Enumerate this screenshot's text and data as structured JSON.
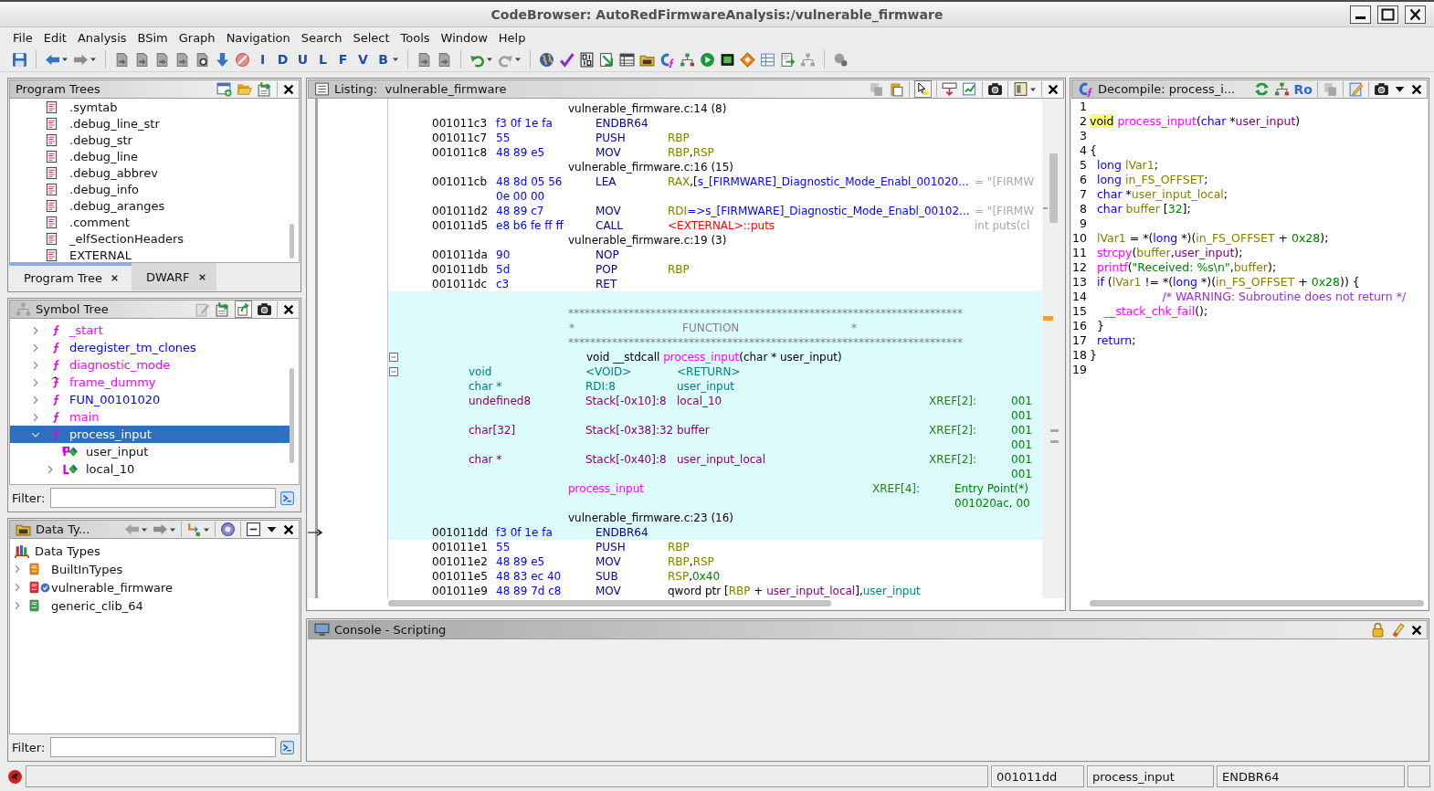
{
  "window": {
    "title": "CodeBrowser: AutoRedFirmwareAnalysis:/vulnerable_firmware"
  },
  "menu": [
    "File",
    "Edit",
    "Analysis",
    "BSim",
    "Graph",
    "Navigation",
    "Search",
    "Select",
    "Tools",
    "Window",
    "Help"
  ],
  "toolbar": {
    "letter_buttons": [
      "I",
      "D",
      "U",
      "L",
      "F",
      "V",
      "B"
    ]
  },
  "program_trees": {
    "title": "Program Trees",
    "items": [
      ".symtab",
      ".debug_line_str",
      ".debug_str",
      ".debug_line",
      ".debug_abbrev",
      ".debug_info",
      ".debug_aranges",
      ".comment",
      "_elfSectionHeaders",
      "EXTERNAL"
    ],
    "tabs": [
      {
        "label": "Program Tree",
        "selected": true
      },
      {
        "label": "DWARF",
        "selected": false
      }
    ]
  },
  "symbol_tree": {
    "title": "Symbol Tree",
    "items": [
      {
        "name": "_start",
        "kind": "function",
        "color": "#ff00ff",
        "expanded": false,
        "selected": false
      },
      {
        "name": "deregister_tm_clones",
        "kind": "function",
        "color": "#0000ff",
        "expanded": false,
        "selected": false
      },
      {
        "name": "diagnostic_mode",
        "kind": "function",
        "color": "#ff00ff",
        "expanded": false,
        "selected": false
      },
      {
        "name": "frame_dummy",
        "kind": "thunk",
        "color": "#ff00ff",
        "expanded": false,
        "selected": false
      },
      {
        "name": "FUN_00101020",
        "kind": "function",
        "color": "#0000ff",
        "expanded": false,
        "selected": false
      },
      {
        "name": "main",
        "kind": "function",
        "color": "#ff00ff",
        "expanded": false,
        "selected": false
      },
      {
        "name": "process_input",
        "kind": "function",
        "expanded": true,
        "selected": true,
        "children": [
          {
            "name": "user_input",
            "kind": "parameter",
            "selected": false
          },
          {
            "name": "local_10",
            "kind": "local",
            "expanded": false,
            "selected": false
          }
        ]
      }
    ],
    "filter": {
      "label": "Filter:"
    }
  },
  "data_types": {
    "title": "Data Ty...",
    "root": {
      "name": "Data Types",
      "children": [
        {
          "name": "BuiltInTypes",
          "kind": "builtin",
          "expanded": false
        },
        {
          "name": "vulnerable_firmware",
          "kind": "program",
          "expanded": false
        },
        {
          "name": "generic_clib_64",
          "kind": "archive",
          "expanded": false
        }
      ]
    },
    "filter": {
      "label": "Filter:"
    }
  },
  "listing": {
    "title": "Listing:  vulnerable_firmware",
    "lines": [
      {
        "kind": "source",
        "text": "vulnerable_firmware.c:14 (8)",
        "highlighted": false
      },
      {
        "kind": "instruction",
        "address": "001011c3",
        "bytes": "f3 0f 1e fa",
        "mnemonic": "ENDBR64",
        "highlighted": false
      },
      {
        "kind": "instruction",
        "address": "001011c7",
        "bytes": "55",
        "mnemonic": "PUSH",
        "operands": [
          {
            "kind": "register",
            "text": "RBP"
          }
        ],
        "highlighted": false
      },
      {
        "kind": "instruction",
        "address": "001011c8",
        "bytes": "48 89 e5",
        "mnemonic": "MOV",
        "operands": [
          {
            "kind": "register",
            "text": "RBP"
          },
          {
            "kind": "plain",
            "text": ","
          },
          {
            "kind": "register",
            "text": "RSP"
          }
        ],
        "highlighted": false
      },
      {
        "kind": "source",
        "text": "vulnerable_firmware.c:16 (15)",
        "highlighted": false
      },
      {
        "kind": "instruction",
        "address": "001011cb",
        "bytes": "48 8d 05 56",
        "mnemonic": "LEA",
        "operands": [
          {
            "kind": "register",
            "text": "RAX"
          },
          {
            "kind": "plain",
            "text": ",["
          },
          {
            "kind": "label",
            "text": "s_[FIRMWARE]_Diagnostic_Mode_Enabl_001020..."
          }
        ],
        "comment": "= \"[FIRMW",
        "highlighted": false
      },
      {
        "kind": "bytes",
        "text": "0e 00 00",
        "highlighted": false
      },
      {
        "kind": "instruction",
        "address": "001011d2",
        "bytes": "48 89 c7",
        "mnemonic": "MOV",
        "operands": [
          {
            "kind": "register",
            "text": "RDI"
          },
          {
            "kind": "label",
            "text": "=>s_[FIRMWARE]_Diagnostic_Mode_Enabl_00102..."
          }
        ],
        "comment": "= \"[FIRMW",
        "highlighted": false
      },
      {
        "kind": "instruction",
        "address": "001011d5",
        "bytes": "e8 b6 fe ff ff",
        "mnemonic": "CALL",
        "operands": [
          {
            "kind": "external",
            "text": "<EXTERNAL>::puts"
          }
        ],
        "comment": "int puts(cl",
        "highlighted": false
      },
      {
        "kind": "source",
        "text": "vulnerable_firmware.c:19 (3)",
        "highlighted": false
      },
      {
        "kind": "instruction",
        "address": "001011da",
        "bytes": "90",
        "mnemonic": "NOP",
        "highlighted": false
      },
      {
        "kind": "instruction",
        "address": "001011db",
        "bytes": "5d",
        "mnemonic": "POP",
        "operands": [
          {
            "kind": "register",
            "text": "RBP"
          }
        ],
        "highlighted": false
      },
      {
        "kind": "instruction",
        "address": "001011dc",
        "bytes": "c3",
        "mnemonic": "RET",
        "highlighted": false
      },
      {
        "kind": "blank",
        "highlighted": true
      },
      {
        "kind": "banner",
        "text": "************************************************************************",
        "highlighted": true
      },
      {
        "kind": "banner_title",
        "left": "*",
        "title": "FUNCTION",
        "right": "*",
        "highlighted": true
      },
      {
        "kind": "banner",
        "text": "************************************************************************",
        "highlighted": true
      },
      {
        "kind": "signature",
        "parts": [
          {
            "kind": "plain",
            "text": "void __stdcall "
          },
          {
            "kind": "function",
            "text": "process_input"
          },
          {
            "kind": "plain",
            "text": "(char * user_input)"
          }
        ],
        "expanded": true,
        "highlighted": true
      },
      {
        "kind": "param",
        "type": "void",
        "storage": "<VOID>",
        "name": "<RETURN>",
        "expanded": true,
        "highlighted": true
      },
      {
        "kind": "param",
        "type": "char *",
        "storage": "RDI:8",
        "name": "user_input",
        "highlighted": true
      },
      {
        "kind": "local",
        "type": "undefined8",
        "storage": "Stack[-0x10]:8",
        "name": "local_10",
        "xref": "XREF[2]:",
        "refs": "001",
        "highlighted": true
      },
      {
        "kind": "refs",
        "text": "001",
        "highlighted": true
      },
      {
        "kind": "local",
        "type": "char[32]",
        "storage": "Stack[-0x38]:32",
        "name": "buffer",
        "xref": "XREF[2]:",
        "refs": "001",
        "highlighted": true
      },
      {
        "kind": "refs",
        "text": "001",
        "highlighted": true
      },
      {
        "kind": "local",
        "type": "char *",
        "storage": "Stack[-0x40]:8",
        "name": "user_input_local",
        "xref": "XREF[2]:",
        "refs": "001",
        "highlighted": true
      },
      {
        "kind": "refs",
        "text": "001",
        "highlighted": true
      },
      {
        "kind": "label",
        "name": "process_input",
        "xref": "XREF[4]:",
        "refs": "Entry Point(*)",
        "highlighted": true
      },
      {
        "kind": "label_refs",
        "text": "001020ac, 00",
        "highlighted": true
      },
      {
        "kind": "source",
        "text": "vulnerable_firmware.c:23 (16)",
        "highlighted": true
      },
      {
        "kind": "instruction",
        "address": "001011dd",
        "bytes": "f3 0f 1e fa",
        "mnemonic": "ENDBR64",
        "highlighted": true,
        "current": true
      },
      {
        "kind": "instruction",
        "address": "001011e1",
        "bytes": "55",
        "mnemonic": "PUSH",
        "operands": [
          {
            "kind": "register",
            "text": "RBP"
          }
        ],
        "highlighted": false
      },
      {
        "kind": "instruction",
        "address": "001011e2",
        "bytes": "48 89 e5",
        "mnemonic": "MOV",
        "operands": [
          {
            "kind": "register",
            "text": "RBP"
          },
          {
            "kind": "plain",
            "text": ","
          },
          {
            "kind": "register",
            "text": "RSP"
          }
        ],
        "highlighted": false
      },
      {
        "kind": "instruction",
        "address": "001011e5",
        "bytes": "48 83 ec 40",
        "mnemonic": "SUB",
        "operands": [
          {
            "kind": "register",
            "text": "RSP"
          },
          {
            "kind": "plain",
            "text": ","
          },
          {
            "kind": "number",
            "text": "0x40"
          }
        ],
        "highlighted": false
      },
      {
        "kind": "instruction",
        "address": "001011e9",
        "bytes": "48 89 7d c8",
        "mnemonic": "MOV",
        "operands": [
          {
            "kind": "plain",
            "text": "qword ptr ["
          },
          {
            "kind": "register",
            "text": "RBP"
          },
          {
            "kind": "plain",
            "text": " + "
          },
          {
            "kind": "var",
            "text": "user_input_local"
          },
          {
            "kind": "plain",
            "text": "],"
          },
          {
            "kind": "param",
            "text": "user_input"
          }
        ],
        "highlighted": false
      }
    ]
  },
  "decompile": {
    "title": "Decompile: process_i...",
    "toggle_label": "Ro",
    "lines": [
      {
        "number": "1"
      },
      {
        "number": "2",
        "tokens": [
          {
            "kind": "highlight",
            "text": "void"
          },
          {
            "kind": "func",
            "text": " process_input"
          },
          {
            "kind": "plain",
            "text": "("
          },
          {
            "kind": "keyword",
            "text": "char"
          },
          {
            "kind": "plain",
            "text": " *"
          },
          {
            "kind": "param",
            "text": "user_input"
          },
          {
            "kind": "plain",
            "text": ")"
          }
        ]
      },
      {
        "number": "3"
      },
      {
        "number": "4",
        "tokens": [
          {
            "kind": "plain",
            "text": "{"
          }
        ]
      },
      {
        "number": "5",
        "tokens": [
          {
            "kind": "keyword",
            "text": "  long"
          },
          {
            "kind": "var",
            "text": " lVar1"
          },
          {
            "kind": "plain",
            "text": ";"
          }
        ]
      },
      {
        "number": "6",
        "tokens": [
          {
            "kind": "keyword",
            "text": "  long"
          },
          {
            "kind": "var",
            "text": " in_FS_OFFSET"
          },
          {
            "kind": "plain",
            "text": ";"
          }
        ]
      },
      {
        "number": "7",
        "tokens": [
          {
            "kind": "keyword",
            "text": "  char"
          },
          {
            "kind": "plain",
            "text": " *"
          },
          {
            "kind": "var",
            "text": "user_input_local"
          },
          {
            "kind": "plain",
            "text": ";"
          }
        ]
      },
      {
        "number": "8",
        "tokens": [
          {
            "kind": "keyword",
            "text": "  char"
          },
          {
            "kind": "var",
            "text": " buffer"
          },
          {
            "kind": "plain",
            "text": " ["
          },
          {
            "kind": "number",
            "text": "32"
          },
          {
            "kind": "plain",
            "text": "];"
          }
        ]
      },
      {
        "number": "9"
      },
      {
        "number": "10",
        "tokens": [
          {
            "kind": "var",
            "text": "  lVar1"
          },
          {
            "kind": "plain",
            "text": " = *("
          },
          {
            "kind": "keyword",
            "text": "long"
          },
          {
            "kind": "plain",
            "text": " *)("
          },
          {
            "kind": "var",
            "text": "in_FS_OFFSET"
          },
          {
            "kind": "plain",
            "text": " + "
          },
          {
            "kind": "number",
            "text": "0x28"
          },
          {
            "kind": "plain",
            "text": ");"
          }
        ]
      },
      {
        "number": "11",
        "tokens": [
          {
            "kind": "func",
            "text": "  strcpy"
          },
          {
            "kind": "plain",
            "text": "("
          },
          {
            "kind": "var",
            "text": "buffer"
          },
          {
            "kind": "plain",
            "text": ","
          },
          {
            "kind": "param",
            "text": "user_input"
          },
          {
            "kind": "plain",
            "text": ");"
          }
        ]
      },
      {
        "number": "12",
        "tokens": [
          {
            "kind": "func",
            "text": "  printf"
          },
          {
            "kind": "plain",
            "text": "("
          },
          {
            "kind": "string",
            "text": "\"Received: %s\\n\""
          },
          {
            "kind": "plain",
            "text": ","
          },
          {
            "kind": "var",
            "text": "buffer"
          },
          {
            "kind": "plain",
            "text": ");"
          }
        ]
      },
      {
        "number": "13",
        "tokens": [
          {
            "kind": "keyword",
            "text": "  if"
          },
          {
            "kind": "plain",
            "text": " ("
          },
          {
            "kind": "var",
            "text": "lVar1"
          },
          {
            "kind": "plain",
            "text": " != *("
          },
          {
            "kind": "keyword",
            "text": "long"
          },
          {
            "kind": "plain",
            "text": " *)("
          },
          {
            "kind": "var",
            "text": "in_FS_OFFSET"
          },
          {
            "kind": "plain",
            "text": " + "
          },
          {
            "kind": "number",
            "text": "0x28"
          },
          {
            "kind": "plain",
            "text": ")) {"
          }
        ]
      },
      {
        "number": "14",
        "tokens": [
          {
            "kind": "comment",
            "text": "                    /* WARNING: Subroutine does not return */"
          }
        ]
      },
      {
        "number": "15",
        "tokens": [
          {
            "kind": "func",
            "text": "    __stack_chk_fail"
          },
          {
            "kind": "plain",
            "text": "();"
          }
        ]
      },
      {
        "number": "16",
        "tokens": [
          {
            "kind": "plain",
            "text": "  }"
          }
        ]
      },
      {
        "number": "17",
        "tokens": [
          {
            "kind": "keyword",
            "text": "  return"
          },
          {
            "kind": "plain",
            "text": ";"
          }
        ]
      },
      {
        "number": "18",
        "tokens": [
          {
            "kind": "plain",
            "text": "}"
          }
        ]
      },
      {
        "number": "19"
      }
    ]
  },
  "console": {
    "title": "Console - Scripting"
  },
  "status_bar": {
    "fields": [
      "001011dd",
      "process_input",
      "ENDBR64"
    ]
  }
}
